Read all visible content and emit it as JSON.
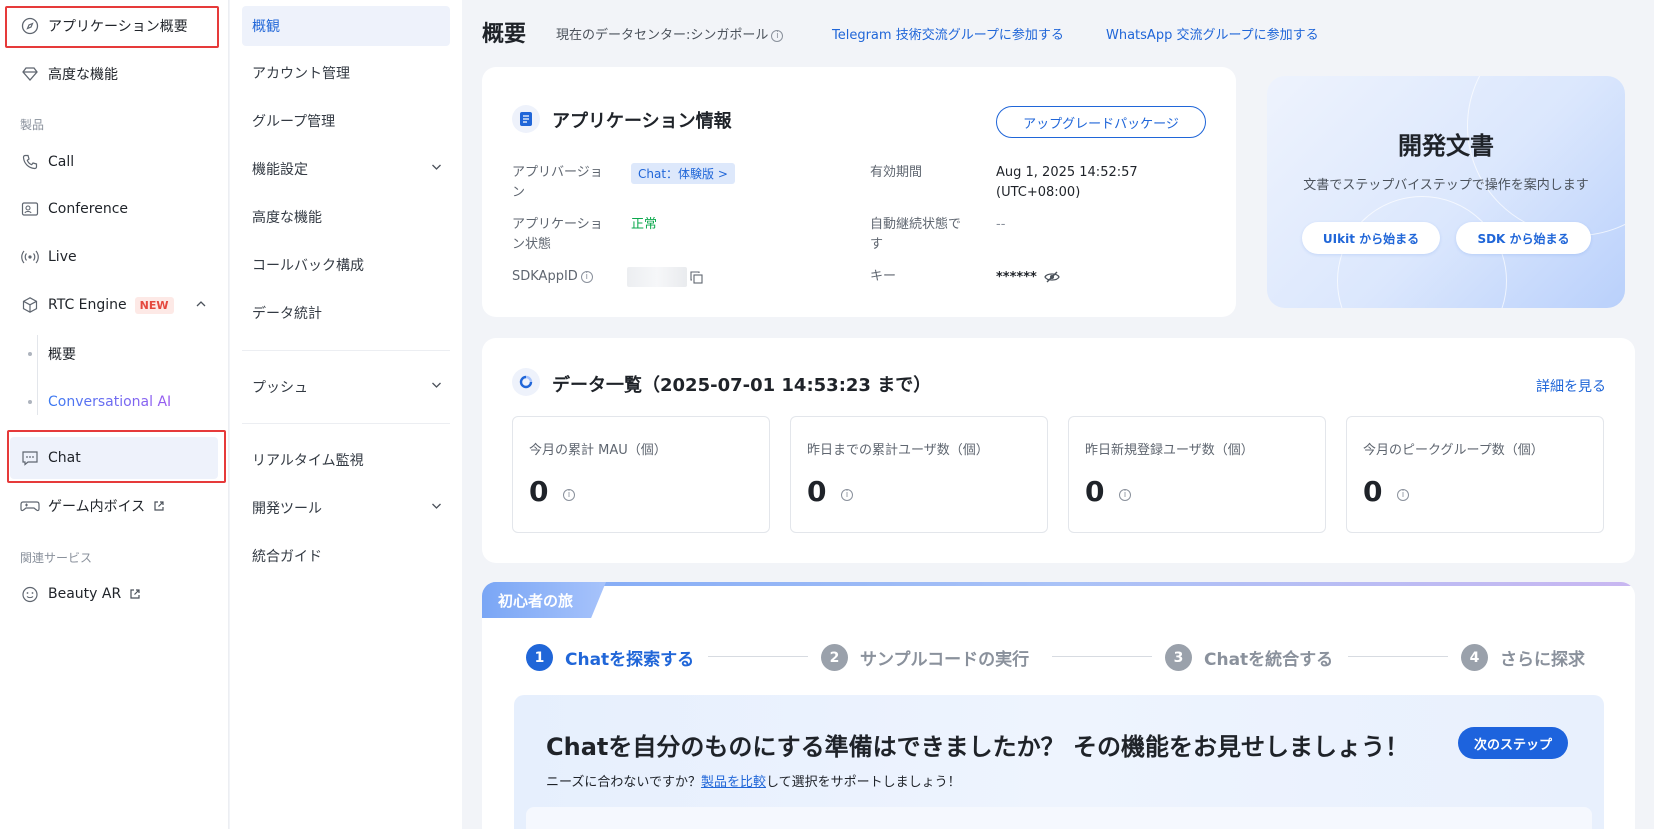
{
  "sidebar": {
    "top_items": [
      {
        "label": "アプリケーション概要",
        "icon": "compass-icon"
      },
      {
        "label": "高度な機能",
        "icon": "diamond-icon"
      }
    ],
    "section_products": "製品",
    "products": [
      {
        "label": "Call",
        "icon": "phone-icon"
      },
      {
        "label": "Conference",
        "icon": "conference-icon"
      },
      {
        "label": "Live",
        "icon": "broadcast-icon"
      },
      {
        "label": "RTC Engine",
        "icon": "cube-icon",
        "badge": "NEW"
      }
    ],
    "rtc_sub": [
      {
        "label": "概要"
      },
      {
        "label": "Conversational AI"
      }
    ],
    "chat": {
      "label": "Chat",
      "icon": "chat-icon"
    },
    "voice": {
      "label": "ゲーム内ボイス",
      "icon": "gamepad-icon"
    },
    "section_related": "関連サービス",
    "beauty": {
      "label": "Beauty AR",
      "icon": "smile-icon"
    }
  },
  "subnav": {
    "items": [
      {
        "label": "概観",
        "active": true
      },
      {
        "label": "アカウント管理"
      },
      {
        "label": "グループ管理"
      },
      {
        "label": "機能設定",
        "expand": true
      },
      {
        "label": "高度な機能"
      },
      {
        "label": "コールバック構成"
      },
      {
        "label": "データ統計"
      }
    ],
    "push": "プッシュ",
    "realtime": "リアルタイム監視",
    "devtools": "開発ツール",
    "guide": "統合ガイド"
  },
  "header": {
    "title": "概要",
    "datacenter": "現在のデータセンター:シンガポール",
    "telegram_link": "Telegram 技術交流グループに参加する",
    "whatsapp_link": "WhatsApp 交流グループに参加する"
  },
  "app_info": {
    "title": "アプリケーション情報",
    "upgrade_button": "アップグレードパッケージ",
    "version_label": "アプリバージョン",
    "version_tag": "Chat：体験版 >",
    "status_label": "アプリケーション状態",
    "status_value": "正常",
    "sdkappid_label": "SDKAppID",
    "expiry_label": "有効期間",
    "expiry_value_1": "Aug 1, 2025 14:52:57",
    "expiry_value_2": "(UTC+08:00)",
    "autorenew_label": "自動継続状態です",
    "autorenew_value": "--",
    "key_label": "キー",
    "key_value": "******"
  },
  "docs": {
    "title": "開発文書",
    "subtitle": "文書でステップバイステップで操作を案内します",
    "uikit_button": "UIkit から始まる",
    "sdk_button": "SDK から始まる"
  },
  "data_overview": {
    "title": "データ一覧（2025-07-01 14:53:23 まで）",
    "detail_link": "詳細を見る",
    "stats": [
      {
        "label": "今月の累計 MAU（個）",
        "value": "0"
      },
      {
        "label": "昨日までの累計ユーザ数（個）",
        "value": "0"
      },
      {
        "label": "昨日新規登録ユーザ数（個）",
        "value": "0"
      },
      {
        "label": "今月のピークグループ数（個）",
        "value": "0"
      }
    ]
  },
  "journey": {
    "tab": "初心者の旅",
    "steps": [
      {
        "num": "1",
        "label": "Chatを探索する",
        "active": true
      },
      {
        "num": "2",
        "label": "サンプルコードの実行"
      },
      {
        "num": "3",
        "label": "Chatを統合する"
      },
      {
        "num": "4",
        "label": "さらに探求"
      }
    ],
    "banner_title": "Chatを自分のものにする準備はできましたか？ その機能をお見せしましょう！",
    "banner_sub_prefix": "ニーズに合わないですか？",
    "banner_sub_link": "製品を比較",
    "banner_sub_suffix": "して選択をサポートしましょう！",
    "next_button": "次のステップ"
  }
}
